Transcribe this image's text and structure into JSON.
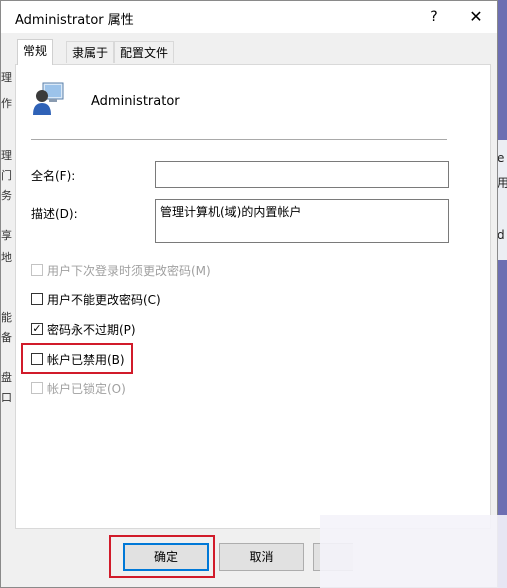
{
  "window": {
    "title": "Administrator 属性",
    "help": "?",
    "close": "✕"
  },
  "tabs": [
    "常规",
    "隶属于",
    "配置文件"
  ],
  "user": {
    "name": "Administrator"
  },
  "form": {
    "fullname_label": "全名(F):",
    "fullname_value": "",
    "desc_label": "描述(D):",
    "desc_value": "管理计算机(域)的内置帐户"
  },
  "checkboxes": [
    {
      "label": "用户下次登录时须更改密码(M)",
      "checked": false,
      "disabled": true
    },
    {
      "label": "用户不能更改密码(C)",
      "checked": false,
      "disabled": false
    },
    {
      "label": "密码永不过期(P)",
      "checked": true,
      "disabled": false
    },
    {
      "label": "帐户已禁用(B)",
      "checked": false,
      "disabled": false
    },
    {
      "label": "帐户已锁定(O)",
      "checked": false,
      "disabled": true
    }
  ],
  "buttons": {
    "ok": "确定",
    "cancel": "取消"
  },
  "background_fragments": {
    "left": [
      "理",
      "作",
      "理",
      "门",
      "务",
      "享",
      "地",
      "能",
      "备",
      "盘",
      "口"
    ],
    "right": [
      "e",
      "用",
      "d"
    ]
  },
  "colors": {
    "highlight": "#d11b2a",
    "desktop": "#6d6fb2",
    "default_button_border": "#0078d7"
  }
}
